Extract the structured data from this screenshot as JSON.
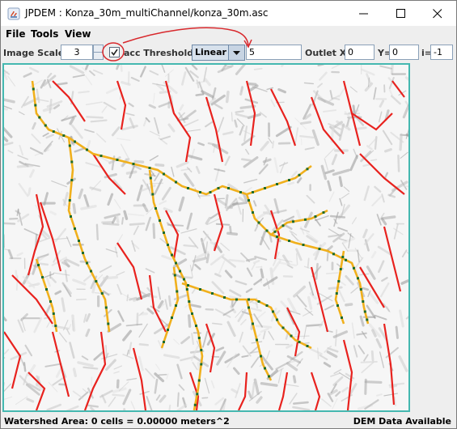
{
  "window": {
    "title": "JPDEM : Konza_30m_multiChannel/konza_30m.asc"
  },
  "menu": {
    "items": [
      {
        "label": "File",
        "mnemonic": "F"
      },
      {
        "label": "Tools",
        "mnemonic": "T"
      },
      {
        "label": "View",
        "mnemonic": "V"
      }
    ]
  },
  "toolbar": {
    "image_scale_label": "Image Scale",
    "image_scale_value": "3",
    "checkbox_checked": true,
    "acc_threshold_label": "acc Threshold",
    "threshold_mode": "Linear",
    "threshold_value": "5",
    "outlet_x_label": "Outlet X=",
    "outlet_x_value": "0",
    "outlet_y_label": "Y=",
    "outlet_y_value": "0",
    "i_label": "i=",
    "i_value": "-1"
  },
  "status": {
    "left": "Watershed Area: 0 cells = 0.00000 meters^2",
    "right": "DEM Data Available"
  },
  "colors": {
    "accent_border": "#45b8b0",
    "stream_small": "#e8221e",
    "stream_large": "#f0b01c",
    "node_marker": "#1e6b2a",
    "annotation": "#d8282c"
  }
}
